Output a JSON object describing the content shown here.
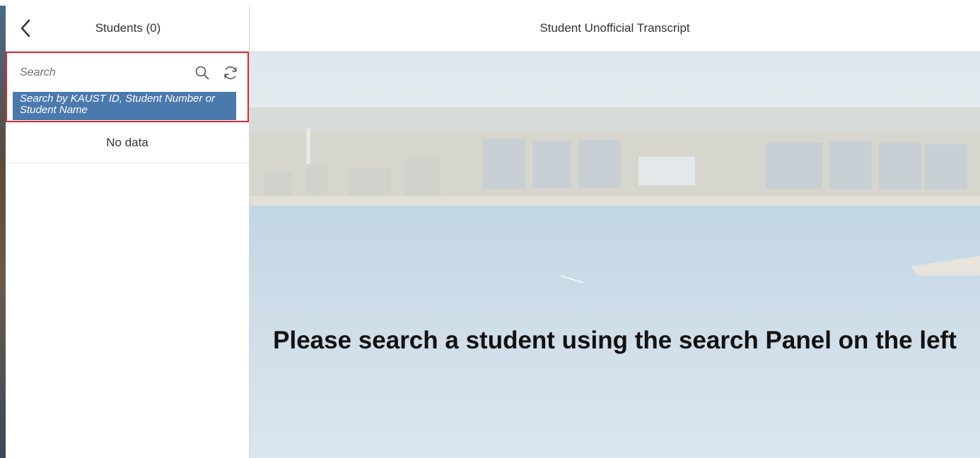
{
  "master": {
    "back_icon": "chevron-left-icon",
    "title": "Students (0)",
    "search": {
      "placeholder": "Search",
      "value": "",
      "search_icon": "search-icon",
      "refresh_icon": "refresh-icon",
      "hint": "Search by KAUST ID, Student Number or Student Name"
    },
    "empty_list_text": "No data"
  },
  "detail": {
    "title": "Student Unofficial Transcript",
    "empty_message": "Please search a student using the search Panel on the left"
  },
  "colors": {
    "hint_background": "#4a79ad",
    "highlight_border": "#e0262e",
    "header_background": "#ffffff"
  }
}
